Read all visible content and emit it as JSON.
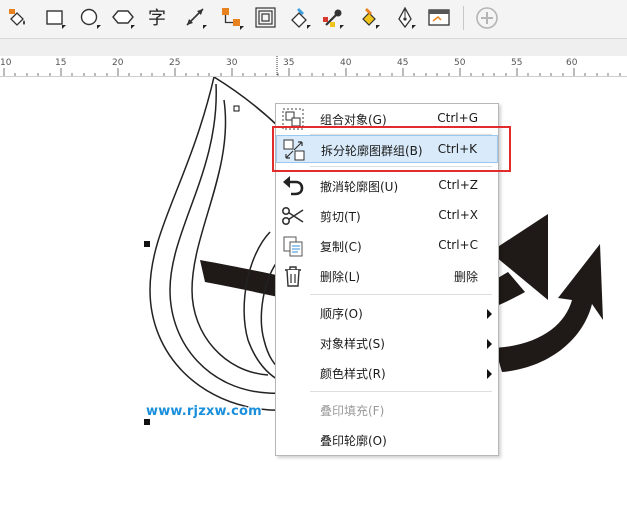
{
  "toolbar": {
    "tools": [
      {
        "icon": "fill-tool-icon"
      },
      {
        "icon": "rectangle-tool-icon"
      },
      {
        "icon": "ellipse-tool-icon"
      },
      {
        "icon": "polygon-tool-icon"
      },
      {
        "icon": "text-tool-icon",
        "glyph": "字"
      },
      {
        "icon": "dimension-tool-icon"
      },
      {
        "icon": "connector-tool-icon"
      },
      {
        "icon": "contour-tool-icon"
      },
      {
        "icon": "interactive-fill-icon"
      },
      {
        "icon": "eyedropper-icon"
      },
      {
        "icon": "smart-fill-icon"
      },
      {
        "icon": "pen-tool-icon"
      },
      {
        "icon": "screen-capture-icon"
      },
      {
        "icon": "add-tool-icon"
      }
    ]
  },
  "ruler": {
    "labels": [
      "10",
      "15",
      "20",
      "25",
      "30",
      "35",
      "40",
      "45",
      "50",
      "55",
      "60"
    ]
  },
  "watermark": "www.rjzxw.com",
  "colors": {
    "highlight_border": "#e22b2b",
    "menu_hover": "#d9ebfa",
    "watermark": "#1a8fdc",
    "arrow_fill": "#1f1a17"
  },
  "context_menu": {
    "items": [
      {
        "id": "group",
        "label": "组合对象(G)",
        "shortcut": "Ctrl+G",
        "icon": "group-objects-icon"
      },
      {
        "id": "break-contour",
        "label": "拆分轮廓图群组(B)",
        "shortcut": "Ctrl+K",
        "icon": "break-apart-icon",
        "highlighted": true
      },
      {
        "id": "undo",
        "label": "撤消轮廓图(U)",
        "shortcut": "Ctrl+Z",
        "icon": "undo-icon"
      },
      {
        "id": "cut",
        "label": "剪切(T)",
        "shortcut": "Ctrl+X",
        "icon": "scissors-icon"
      },
      {
        "id": "copy",
        "label": "复制(C)",
        "shortcut": "Ctrl+C",
        "icon": "copy-icon"
      },
      {
        "id": "delete",
        "label": "删除(L)",
        "shortcut": "删除",
        "icon": "trash-icon"
      },
      {
        "id": "order",
        "label": "顺序(O)",
        "submenu": true
      },
      {
        "id": "object-styles",
        "label": "对象样式(S)",
        "submenu": true
      },
      {
        "id": "color-styles",
        "label": "颜色样式(R)",
        "submenu": true
      },
      {
        "id": "overprint-fill",
        "label": "叠印填充(F)",
        "disabled": true
      },
      {
        "id": "overprint-outline",
        "label": "叠印轮廓(O)"
      }
    ]
  }
}
